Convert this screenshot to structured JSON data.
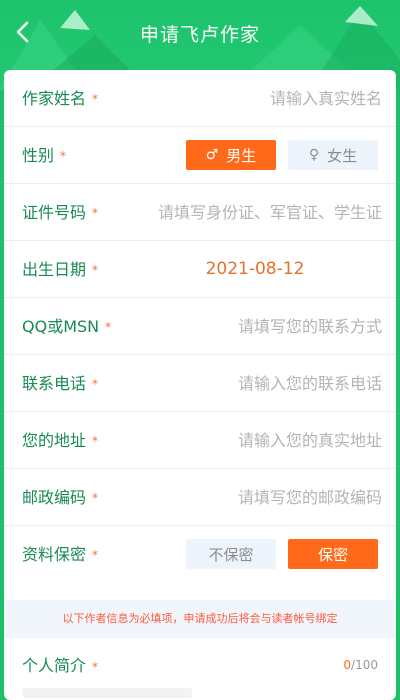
{
  "header": {
    "title": "申请飞卢作家",
    "back_icon": "chevron-left-icon"
  },
  "form": {
    "name": {
      "label": "作家姓名",
      "placeholder": "请输入真实姓名"
    },
    "gender": {
      "label": "性别",
      "male": "男生",
      "female": "女生",
      "selected": "男生"
    },
    "id_number": {
      "label": "证件号码",
      "placeholder": "请填写身份证、军官证、学生证"
    },
    "birth_date": {
      "label": "出生日期",
      "value": "2021-08-12"
    },
    "qq_msn": {
      "label": "QQ或MSN",
      "placeholder": "请填写您的联系方式"
    },
    "phone": {
      "label": "联系电话",
      "placeholder": "请输入您的联系电话"
    },
    "address": {
      "label": "您的地址",
      "placeholder": "请输入您的真实地址"
    },
    "postcode": {
      "label": "邮政编码",
      "placeholder": "请填写您的邮政编码"
    },
    "privacy": {
      "label": "资料保密",
      "off": "不保密",
      "on": "保密",
      "selected": "保密"
    },
    "required_star": "*"
  },
  "notice": "以下作者信息为必填项，申请成功后将会与读者帐号绑定",
  "intro": {
    "label": "个人简介",
    "count_current": "0",
    "count_max": "/100"
  },
  "colors": {
    "brand_green": "#1fbf6a",
    "accent_orange": "#ff6a1a",
    "label_green": "#1a8a55"
  }
}
